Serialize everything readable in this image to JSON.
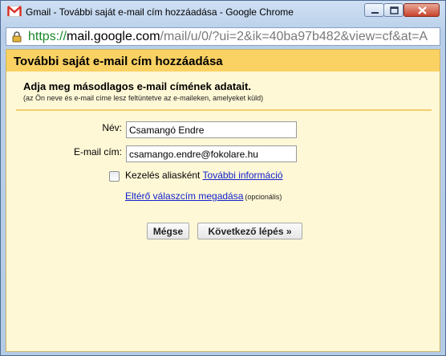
{
  "window": {
    "title": "Gmail - További saját e-mail cím hozzáadása - Google Chrome"
  },
  "address_bar": {
    "scheme": "https://",
    "host": "mail.google.com",
    "path": "/mail/u/0/?ui=2&ik=40ba97b482&view=cf&at=A"
  },
  "dialog": {
    "header": "További saját e-mail cím hozzáadása",
    "intro_title": "Adja meg másodlagos e-mail címének adatait.",
    "intro_subtitle": "(az Ön neve és e-mail címe lesz feltüntetve az e-maileken, amelyeket küld)",
    "name_label": "Név:",
    "name_value": "Csamangó Endre",
    "email_label": "E-mail cím:",
    "email_value": "csamango.endre@fokolare.hu",
    "alias_label": "Kezelés aliasként",
    "alias_checked": false,
    "more_info_link": "További információ",
    "reply_to_link": "Eltérő válaszcím megadása",
    "optional_text": "(opcionális)",
    "cancel_button": "Mégse",
    "next_button": "Következő lépés »"
  },
  "colors": {
    "header_bg": "#fad163",
    "page_bg": "#fff8d6",
    "link": "#1122cc",
    "url_scheme": "#1a8a2a"
  }
}
